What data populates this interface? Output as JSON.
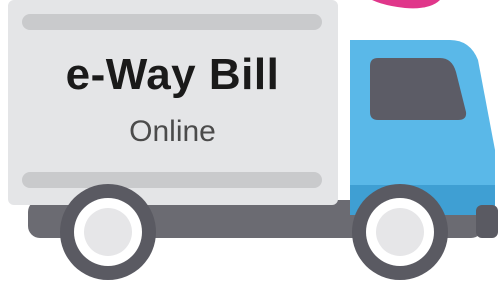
{
  "cargo_box": {
    "title": "e-Way Bill",
    "subtitle": "Online"
  },
  "colors": {
    "cargo_body": "#e4e5e7",
    "cargo_stripe": "#c9cacc",
    "cab": "#5ab8e8",
    "cab_dark": "#3f9fd3",
    "window": "#5c5c66",
    "chassis": "#6b6b72",
    "tire": "#5a5a62",
    "hub": "#e6e6e8",
    "accent_pink": "#e0368a"
  }
}
